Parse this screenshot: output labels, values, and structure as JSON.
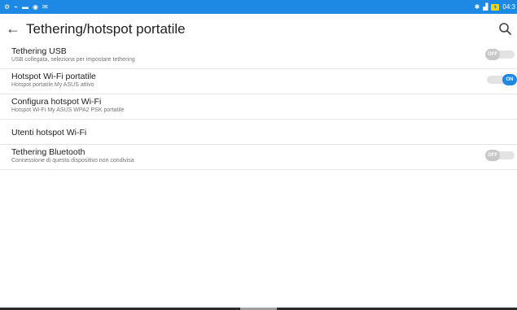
{
  "status_bar": {
    "time": "04:3",
    "left_icons": [
      "settings-icon",
      "usb-icon",
      "message-icon",
      "assistant-icon",
      "mail-icon"
    ],
    "right_icons": [
      "bluetooth-icon",
      "signal-icon",
      "battery-charging-icon"
    ],
    "bg_color": "#1e88e5"
  },
  "toolbar": {
    "title": "Tethering/hotspot portatile",
    "back_icon": "back-arrow-icon",
    "search_icon": "search-icon"
  },
  "settings": [
    {
      "title": "Tethering USB",
      "subtitle": "USB collegata, seleziona per impostare tethering",
      "toggle": "OFF"
    },
    {
      "title": "Hotspot Wi-Fi portatile",
      "subtitle": "Hotspot portatile My ASUS attivo",
      "toggle": "ON"
    },
    {
      "title": "Configura hotspot Wi-Fi",
      "subtitle": "Hotspot Wi-Fi My ASUS WPA2 PSK portatile"
    },
    {
      "title": "Utenti hotspot Wi-Fi"
    },
    {
      "title": "Tethering Bluetooth",
      "subtitle": "Connessione di questo dispositivo non condivisa",
      "toggle": "OFF"
    }
  ],
  "colors": {
    "accent": "#1e88e5",
    "toggle_off": "#c8c8c8"
  }
}
